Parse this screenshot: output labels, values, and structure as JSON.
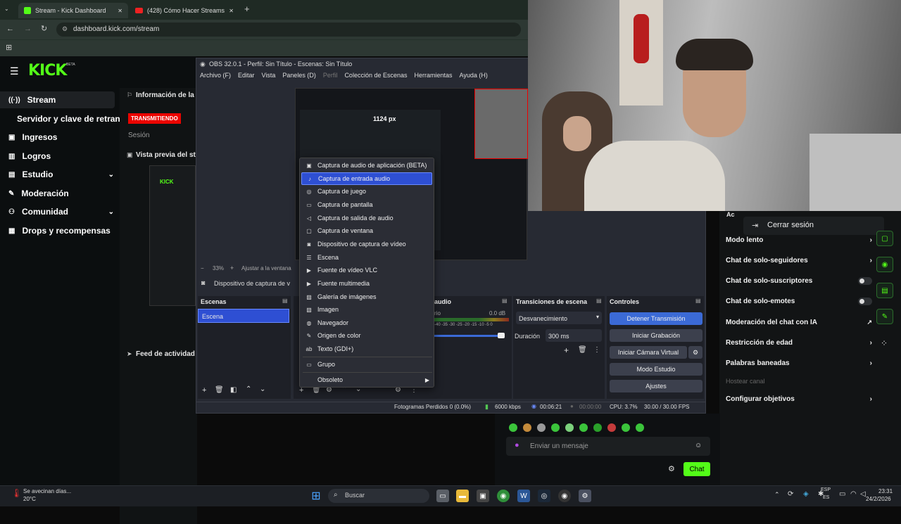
{
  "browser": {
    "tabs": [
      {
        "title": "Stream - Kick Dashboard",
        "active": true
      },
      {
        "title": "(428) Cómo Hacer Streams en K",
        "active": false
      }
    ],
    "url": "dashboard.kick.com/stream",
    "close_glyph": "✕",
    "new_tab_glyph": "+"
  },
  "kick": {
    "logo": "KICK",
    "logo_badge": "BETA",
    "nav": [
      {
        "label": "Stream",
        "icon": "broadcast-icon"
      },
      {
        "label": "Servidor y clave de retransmisión",
        "icon": ""
      },
      {
        "label": "Ingresos",
        "icon": "dollar-icon"
      },
      {
        "label": "Logros",
        "icon": "trophy-icon"
      },
      {
        "label": "Estudio",
        "icon": "studio-icon"
      },
      {
        "label": "Moderación",
        "icon": "wrench-icon"
      },
      {
        "label": "Comunidad",
        "icon": "people-icon"
      },
      {
        "label": "Drops y recompensas",
        "icon": "gift-icon"
      }
    ],
    "stream_info_title": "Información de la se",
    "live_badge": "TRANSMITIENDO",
    "session_label": "Sesión",
    "preview_title": "Vista previa del str",
    "activity_feed": "Feed de actividad",
    "cerrar_sesion": "Cerrar sesión"
  },
  "obs": {
    "title": "OBS 32.0.1 - Perfil: Sin Título - Escenas: Sin Título",
    "menu": [
      "Archivo (F)",
      "Editar",
      "Vista",
      "Paneles (D)",
      "Perfil",
      "Colección de Escenas",
      "Herramientas",
      "Ayuda (H)"
    ],
    "zoom": "33%",
    "fit_label": "Ajustar a la ventana",
    "source_label": "Dispositivo de captura de v",
    "scenes_title": "Escenas",
    "scene_item": "Escena",
    "audio_title": "audio",
    "audio_db": "0.0 dB",
    "audio_label": "rio",
    "audio_scale": "-40 -35 -30 -25 -20 -15 -10 -5 0",
    "transitions_title": "Transiciones de escena",
    "transition_value": "Desvanecimiento",
    "duration_label": "Duración",
    "duration_value": "300 ms",
    "controls_title": "Controles",
    "controls": [
      "Detener Transmisión",
      "Iniciar Grabación",
      "Iniciar Cámara Virtual",
      "Modo Estudio",
      "Ajustes"
    ],
    "status": {
      "dropped": "Fotogramas Perdidos 0 (0.0%)",
      "bitrate": "6000 kbps",
      "live_time": "00:06:21",
      "rec_time": "00:00:00",
      "cpu": "CPU: 3.7%",
      "fps": "30.00 / 30.00 FPS"
    },
    "preview_size": "1124 px"
  },
  "context_menu": {
    "items": [
      {
        "label": "Captura de audio de aplicación (BETA)",
        "icon": "app-audio-icon",
        "selected": false
      },
      {
        "label": "Captura de entrada audio",
        "icon": "microphone-icon",
        "selected": true
      },
      {
        "label": "Captura de juego",
        "icon": "gamepad-icon",
        "selected": false
      },
      {
        "label": "Captura de pantalla",
        "icon": "monitor-icon",
        "selected": false
      },
      {
        "label": "Captura de salida de audio",
        "icon": "speaker-icon",
        "selected": false
      },
      {
        "label": "Captura de ventana",
        "icon": "window-icon",
        "selected": false
      },
      {
        "label": "Dispositivo de captura de vídeo",
        "icon": "camera-icon",
        "selected": false
      },
      {
        "label": "Escena",
        "icon": "list-icon",
        "selected": false
      },
      {
        "label": "Fuente de vídeo VLC",
        "icon": "play-icon",
        "selected": false
      },
      {
        "label": "Fuente multimedia",
        "icon": "play-icon",
        "selected": false
      },
      {
        "label": "Galería de imágenes",
        "icon": "gallery-icon",
        "selected": false
      },
      {
        "label": "Imagen",
        "icon": "image-icon",
        "selected": false
      },
      {
        "label": "Navegador",
        "icon": "globe-icon",
        "selected": false
      },
      {
        "label": "Origen de color",
        "icon": "palette-icon",
        "selected": false
      },
      {
        "label": "Texto (GDI+)",
        "icon": "text-icon",
        "selected": false
      },
      {
        "label": "Grupo",
        "icon": "folder-icon",
        "selected": false
      },
      {
        "label": "Obsoleto",
        "icon": "",
        "selected": false
      }
    ]
  },
  "settings_panel": {
    "header": "Ac",
    "items": [
      {
        "label": "Modo lento",
        "control": "chevron"
      },
      {
        "label": "Chat de solo-seguidores",
        "control": "chevron"
      },
      {
        "label": "Chat de solo-suscriptores",
        "control": "toggle"
      },
      {
        "label": "Chat de solo-emotes",
        "control": "toggle"
      },
      {
        "label": "Moderación del chat con IA",
        "control": "external"
      },
      {
        "label": "Restricción de edad",
        "control": "chevron"
      },
      {
        "label": "Palabras baneadas",
        "control": "chevron"
      },
      {
        "label": "Hostear canal",
        "control": "none"
      },
      {
        "label": "Configurar objetivos",
        "control": "chevron"
      }
    ]
  },
  "chat": {
    "placeholder": "Enviar un mensaje",
    "send_label": "Chat"
  },
  "taskbar": {
    "weather_text": "Se avecinan días...",
    "weather_temp": "20°C",
    "search_label": "Buscar",
    "lang_top": "ESP",
    "lang_bottom": "ES",
    "time": "23:31",
    "date": "24/2/2026"
  },
  "colors": {
    "kick_green": "#53fc18",
    "live_red": "#eb0400",
    "obs_blue": "#2e4fd3"
  }
}
